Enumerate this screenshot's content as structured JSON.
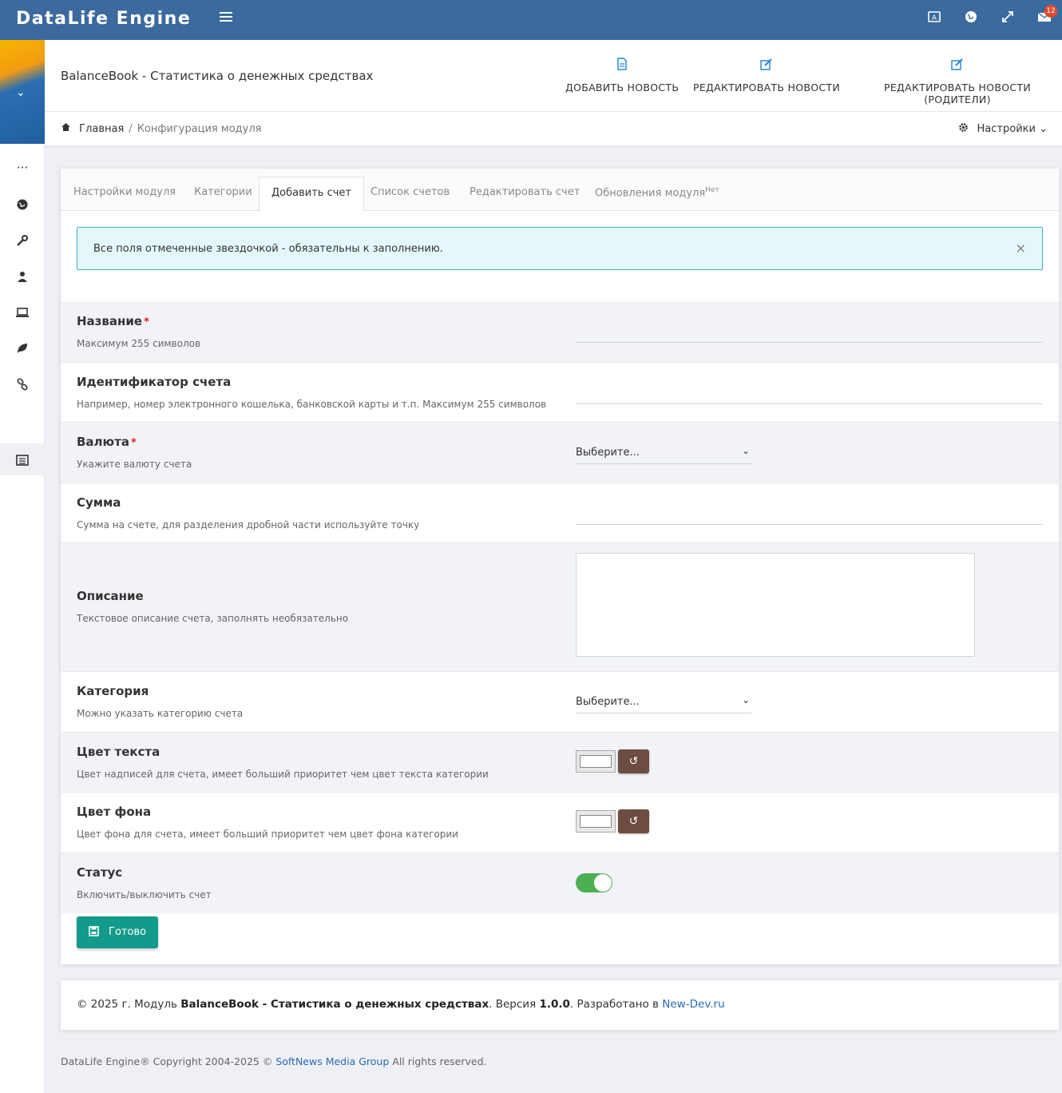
{
  "app": {
    "brand": "DataLife Engine",
    "notification_count": "12"
  },
  "icons": {
    "menu": "hamburger-icon",
    "topbar": [
      "language-icon",
      "globe-icon",
      "fullscreen-icon",
      "mail-icon"
    ],
    "sidebar": [
      "more-icon",
      "globe-icon",
      "wrench-icon",
      "user-icon",
      "laptop-icon",
      "leaf-icon",
      "link-icon",
      "list-icon"
    ]
  },
  "header": {
    "title": "BalanceBook - Статистика о денежных средствах",
    "actions": [
      {
        "label": "ДОБАВИТЬ НОВОСТЬ",
        "icon": "file-icon"
      },
      {
        "label": "РЕДАКТИРОВАТЬ НОВОСТИ",
        "icon": "edit-icon"
      },
      {
        "label": "РЕДАКТИРОВАТЬ НОВОСТИ (РОДИТЕЛИ)",
        "icon": "edit-icon"
      }
    ]
  },
  "breadcrumb": {
    "home": "Главная",
    "separator": "/",
    "current": "Конфигурация модуля"
  },
  "settings": {
    "label": "Настройки"
  },
  "tabs": [
    {
      "label": "Настройки модуля"
    },
    {
      "label": "Категории"
    },
    {
      "label": "Добавить счет",
      "active": true
    },
    {
      "label": "Список счетов"
    },
    {
      "label": "Редактировать счет"
    },
    {
      "label": "Обновления модуля",
      "badge": "Нет"
    }
  ],
  "alert": {
    "text": "Все поля отмеченные звездочкой - обязательны к заполнению.",
    "close": "×"
  },
  "form": {
    "required_mark": "*",
    "fields": [
      {
        "label": "Название",
        "desc": "Максимум 255 символов",
        "required": true,
        "value": ""
      },
      {
        "label": "Идентификатор счета",
        "desc": "Например, номер электронного кошелька, банковской карты и т.п. Максимум 255 символов",
        "value": ""
      },
      {
        "label": "Валюта",
        "desc": "Укажите валюту счета",
        "required": true,
        "selected": "Выберите..."
      },
      {
        "label": "Сумма",
        "desc": "Сумма на счете, для разделения дробной части используйте точку",
        "value": ""
      },
      {
        "label": "Описание",
        "desc": "Текстовое описание счета, заполнять необязательно",
        "value": ""
      },
      {
        "label": "Категория",
        "desc": "Можно указать категорию счета",
        "selected": "Выберите..."
      },
      {
        "label": "Цвет текста",
        "desc": "Цвет надписей для счета, имеет больший приоритет чем цвет текста категории",
        "color": "#ffffff"
      },
      {
        "label": "Цвет фона",
        "desc": "Цвет фона для счета, имеет больший приоритет чем цвет фона категории",
        "color": "#ffffff"
      },
      {
        "label": "Статус",
        "desc": "Включить/выключить счет",
        "enabled": true
      }
    ],
    "submit": "Готово"
  },
  "footer": {
    "prefix": "© 2025 г. Модуль ",
    "module": "BalanceBook - Статистика о денежных средствах",
    "version_prefix": ". Версия ",
    "version": "1.0.0",
    "dev_prefix": ". Разработано в ",
    "dev_link": "New-Dev.ru"
  },
  "copyright": {
    "prefix": "DataLife Engine® Copyright 2004-2025 © ",
    "company": "SoftNews Media Group",
    "suffix": " All rights reserved."
  },
  "colors": {
    "topbar": "#3b6a9e",
    "accent": "#2a8bd6",
    "save": "#129b8a",
    "reset": "#6d4c41",
    "toggle": "#4caf50",
    "alert_border": "#44b4c2"
  }
}
